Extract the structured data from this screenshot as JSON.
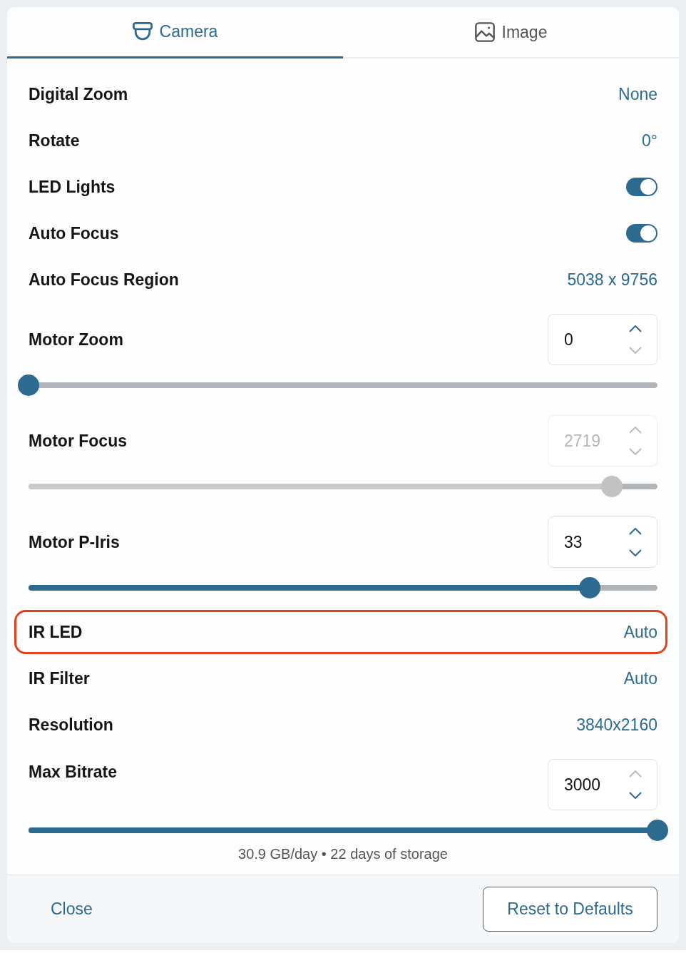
{
  "tabs": [
    {
      "label": "Camera",
      "selected": true
    },
    {
      "label": "Image",
      "selected": false
    }
  ],
  "settings": [
    {
      "kind": "value",
      "label": "Digital Zoom",
      "value": "None",
      "highlighted": false
    },
    {
      "kind": "value",
      "label": "Rotate",
      "value": "0°",
      "highlighted": false
    },
    {
      "kind": "toggle",
      "label": "LED Lights",
      "on": true,
      "highlighted": false
    },
    {
      "kind": "toggle",
      "label": "Auto Focus",
      "on": true,
      "highlighted": false
    },
    {
      "kind": "value",
      "label": "Auto Focus Region",
      "value": "5038 x 9756",
      "highlighted": false
    },
    {
      "kind": "slider",
      "label": "Motor Zoom",
      "value": "0",
      "disabled": false,
      "up_disabled": false,
      "down_disabled": true,
      "level": 0,
      "highlighted": false
    },
    {
      "kind": "slider",
      "label": "Motor Focus",
      "value": "2719",
      "disabled": true,
      "up_disabled": true,
      "down_disabled": true,
      "level": 0.927,
      "highlighted": false
    },
    {
      "kind": "slider",
      "label": "Motor P-Iris",
      "value": "33",
      "disabled": false,
      "up_disabled": false,
      "down_disabled": false,
      "level": 0.892,
      "highlighted": false
    },
    {
      "kind": "value",
      "label": "IR LED",
      "value": "Auto",
      "highlighted": true
    },
    {
      "kind": "value",
      "label": "IR Filter",
      "value": "Auto",
      "highlighted": false
    },
    {
      "kind": "value",
      "label": "Resolution",
      "value": "3840x2160",
      "highlighted": false
    },
    {
      "kind": "slider",
      "label": "Max Bitrate",
      "value": "3000",
      "disabled": false,
      "up_disabled": true,
      "down_disabled": false,
      "level": 1,
      "caption": "30.9 GB/day • 22 days of storage",
      "highlighted": false
    }
  ],
  "footer": {
    "close_button": "Close",
    "reset_button": "Reset to Defaults"
  }
}
